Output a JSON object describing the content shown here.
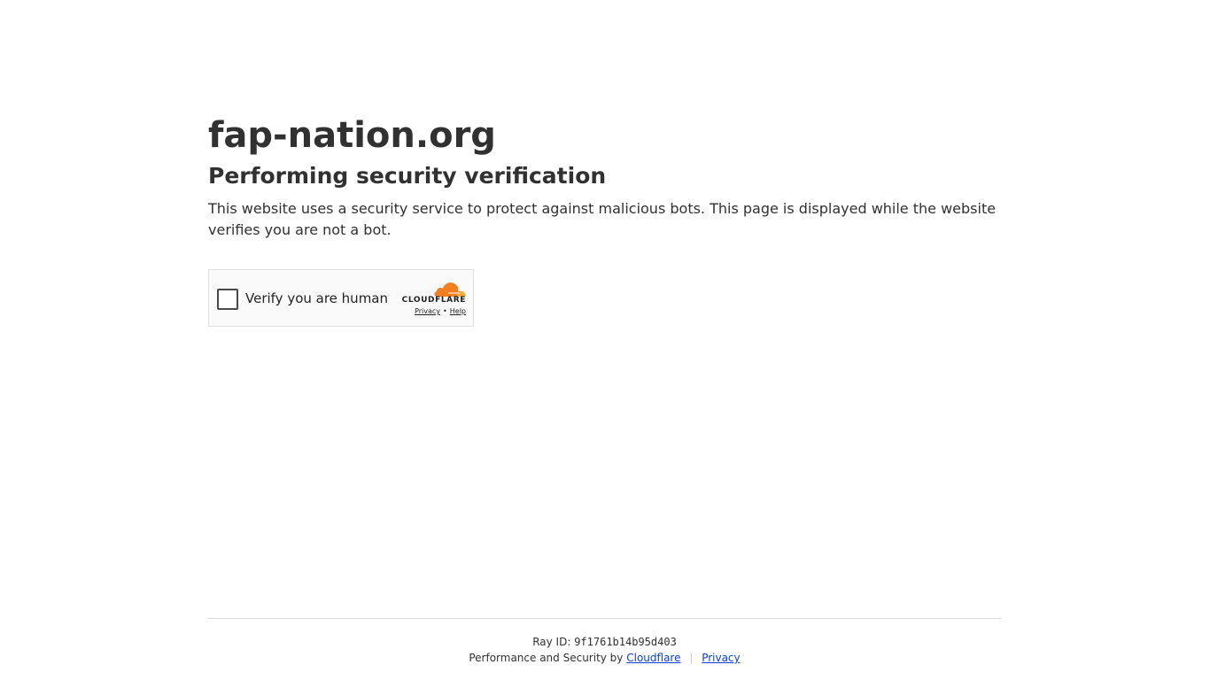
{
  "site": {
    "domain": "fap-nation.org",
    "heading": "Performing security verification",
    "description": "This website uses a security service to protect against malicious bots. This page is displayed while the website verifies you are not a bot."
  },
  "challenge": {
    "checkbox_label": "Verify you are human",
    "brand_name": "CLOUDFLARE",
    "privacy_link": "Privacy",
    "separator": "•",
    "help_link": "Help",
    "brand_colors": {
      "orange": "#f38020",
      "light_orange": "#faae40"
    }
  },
  "footer": {
    "ray_label": "Ray ID:",
    "ray_id": "9f1761b14b95d403",
    "performance_text": "Performance and Security by",
    "cloudflare_link": "Cloudflare",
    "divider": "|",
    "privacy_link": "Privacy",
    "link_color": "#0b3eda"
  }
}
